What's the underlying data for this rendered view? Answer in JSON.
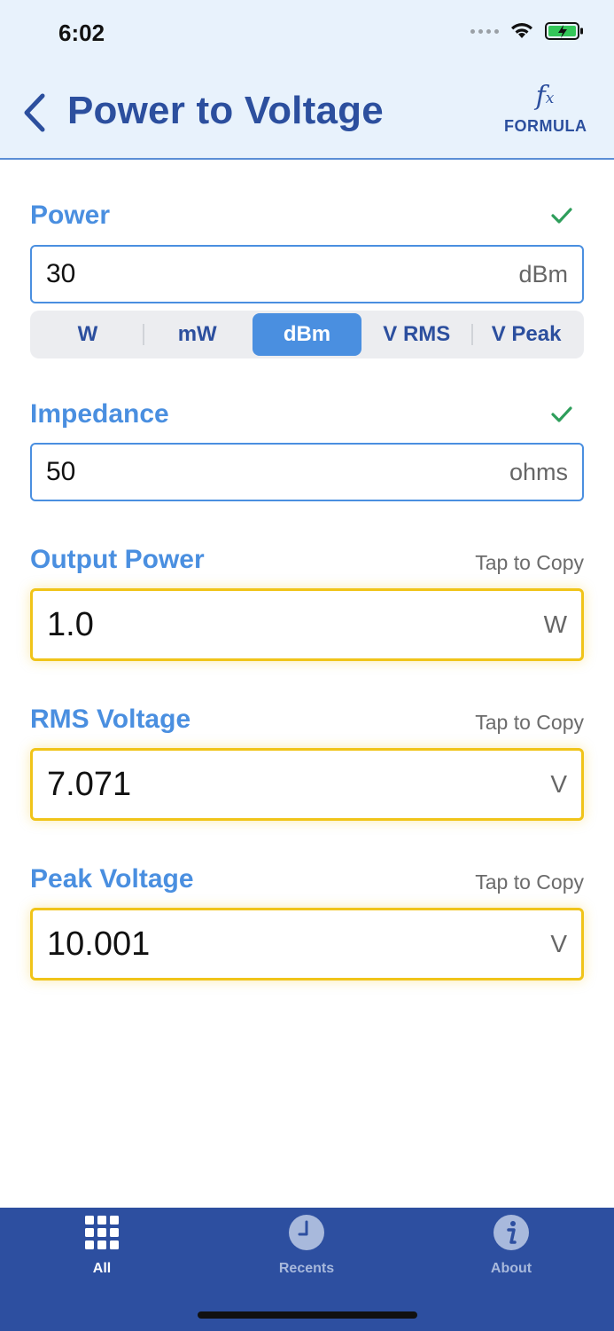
{
  "status_bar": {
    "time": "6:02"
  },
  "header": {
    "title": "Power to Voltage",
    "formula_label": "FORMULA",
    "formula_mark": "fx"
  },
  "power": {
    "label": "Power",
    "value": "30",
    "unit": "dBm",
    "unit_options": [
      "W",
      "mW",
      "dBm",
      "V RMS",
      "V Peak"
    ],
    "selected_unit": "dBm"
  },
  "impedance": {
    "label": "Impedance",
    "value": "50",
    "unit": "ohms"
  },
  "outputs": [
    {
      "label": "Output Power",
      "copy_hint": "Tap to Copy",
      "value": "1.0",
      "unit": "W"
    },
    {
      "label": "RMS Voltage",
      "copy_hint": "Tap to Copy",
      "value": "7.071",
      "unit": "V"
    },
    {
      "label": "Peak Voltage",
      "copy_hint": "Tap to Copy",
      "value": "10.001",
      "unit": "V"
    }
  ],
  "tabbar": {
    "items": [
      {
        "label": "All",
        "icon": "grid-icon",
        "active": true
      },
      {
        "label": "Recents",
        "icon": "clock-icon",
        "active": false
      },
      {
        "label": "About",
        "icon": "info-icon",
        "active": false
      }
    ]
  },
  "colors": {
    "accent": "#4a8fe0",
    "title": "#2c4f9e",
    "header_bg": "#e8f2fc",
    "output_border": "#f0c419",
    "tabbar_bg": "#2d4fa0",
    "check": "#2e9e5b"
  }
}
